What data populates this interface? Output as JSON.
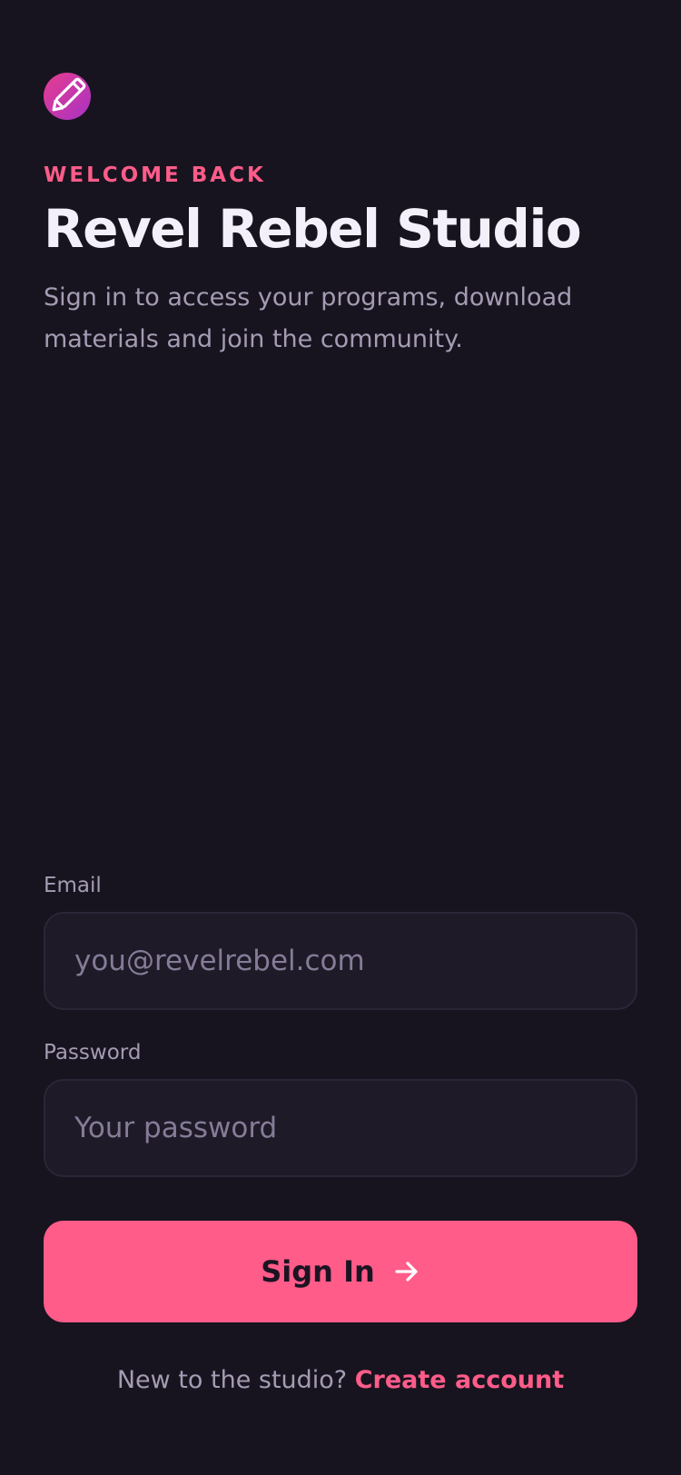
{
  "brand": {
    "logo_icon": "pencil-icon",
    "gradient": [
      "#e63d8f",
      "#a832c4"
    ]
  },
  "header": {
    "eyebrow": "WELCOME BACK",
    "title": "Revel Rebel Studio",
    "subtitle": "Sign in to access your programs, download materials and join the community."
  },
  "form": {
    "email": {
      "label": "Email",
      "value": "",
      "placeholder": "you@revelrebel.com"
    },
    "password": {
      "label": "Password",
      "value": "",
      "placeholder": "Your password"
    },
    "submit_label": "Sign In",
    "submit_icon": "arrow-right-icon"
  },
  "footer": {
    "prompt": "New to the studio?",
    "link": "Create account"
  },
  "colors": {
    "background": "#18141f",
    "accent": "#ff5c8a",
    "input_bg": "#1e1a28",
    "muted_text": "#a49cb4"
  }
}
